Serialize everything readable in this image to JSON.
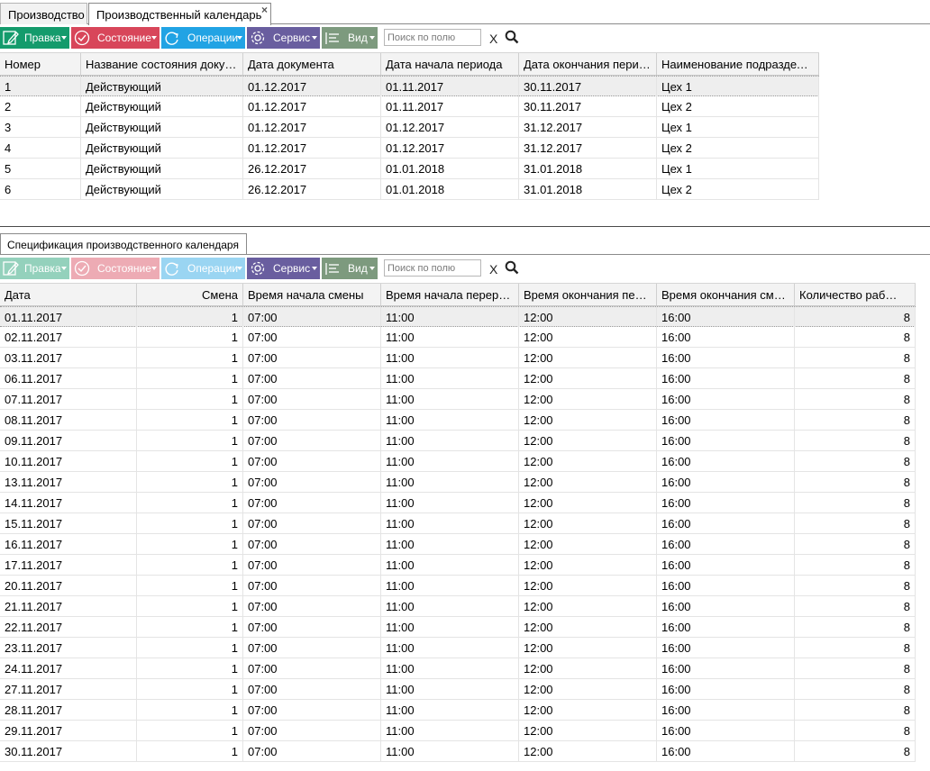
{
  "tabs": [
    {
      "label": "Производство"
    },
    {
      "label": "Производственный календарь",
      "close": "×"
    }
  ],
  "toolbar": {
    "edit_label": "Правка",
    "state_label": "Состояние",
    "ops_label": "Операции",
    "service_label": "Сервис",
    "view_label": "Вид",
    "search_placeholder": "Поиск по полю",
    "clear_label": "X"
  },
  "colors": {
    "edit": "#149b6c",
    "state": "#d8465a",
    "ops": "#21a3e4",
    "service": "#695e9f",
    "view": "#7d9a7e"
  },
  "icons": [
    "pencil-icon",
    "check-circle-icon",
    "refresh-icon",
    "gear-icon",
    "list-icon",
    "search-icon",
    "close-icon"
  ],
  "calendar_table": {
    "columns": [
      "Номер",
      "Название состояния доку…",
      "Дата документа",
      "Дата начала периода",
      "Дата окончания пери…",
      "Наименование подраздел…"
    ],
    "rows": [
      [
        "1",
        "Действующий",
        "01.12.2017",
        "01.11.2017",
        "30.11.2017",
        "Цех 1"
      ],
      [
        "2",
        "Действующий",
        "01.12.2017",
        "01.11.2017",
        "30.11.2017",
        "Цех 2"
      ],
      [
        "3",
        "Действующий",
        "01.12.2017",
        "01.12.2017",
        "31.12.2017",
        "Цех 1"
      ],
      [
        "4",
        "Действующий",
        "01.12.2017",
        "01.12.2017",
        "31.12.2017",
        "Цех 2"
      ],
      [
        "5",
        "Действующий",
        "26.12.2017",
        "01.01.2018",
        "31.01.2018",
        "Цех 1"
      ],
      [
        "6",
        "Действующий",
        "26.12.2017",
        "01.01.2018",
        "31.01.2018",
        "Цех 2"
      ]
    ]
  },
  "spec_tab": {
    "label": "Спецификация производственного календаря"
  },
  "spec_table": {
    "columns": [
      "Дата",
      "Смена",
      "Время начала смены",
      "Время начала перер…",
      "Время окончания пер…",
      "Время окончания см…",
      "Количество раб…"
    ],
    "rows": [
      [
        "01.11.2017",
        "1",
        "07:00",
        "11:00",
        "12:00",
        "16:00",
        "8"
      ],
      [
        "02.11.2017",
        "1",
        "07:00",
        "11:00",
        "12:00",
        "16:00",
        "8"
      ],
      [
        "03.11.2017",
        "1",
        "07:00",
        "11:00",
        "12:00",
        "16:00",
        "8"
      ],
      [
        "06.11.2017",
        "1",
        "07:00",
        "11:00",
        "12:00",
        "16:00",
        "8"
      ],
      [
        "07.11.2017",
        "1",
        "07:00",
        "11:00",
        "12:00",
        "16:00",
        "8"
      ],
      [
        "08.11.2017",
        "1",
        "07:00",
        "11:00",
        "12:00",
        "16:00",
        "8"
      ],
      [
        "09.11.2017",
        "1",
        "07:00",
        "11:00",
        "12:00",
        "16:00",
        "8"
      ],
      [
        "10.11.2017",
        "1",
        "07:00",
        "11:00",
        "12:00",
        "16:00",
        "8"
      ],
      [
        "13.11.2017",
        "1",
        "07:00",
        "11:00",
        "12:00",
        "16:00",
        "8"
      ],
      [
        "14.11.2017",
        "1",
        "07:00",
        "11:00",
        "12:00",
        "16:00",
        "8"
      ],
      [
        "15.11.2017",
        "1",
        "07:00",
        "11:00",
        "12:00",
        "16:00",
        "8"
      ],
      [
        "16.11.2017",
        "1",
        "07:00",
        "11:00",
        "12:00",
        "16:00",
        "8"
      ],
      [
        "17.11.2017",
        "1",
        "07:00",
        "11:00",
        "12:00",
        "16:00",
        "8"
      ],
      [
        "20.11.2017",
        "1",
        "07:00",
        "11:00",
        "12:00",
        "16:00",
        "8"
      ],
      [
        "21.11.2017",
        "1",
        "07:00",
        "11:00",
        "12:00",
        "16:00",
        "8"
      ],
      [
        "22.11.2017",
        "1",
        "07:00",
        "11:00",
        "12:00",
        "16:00",
        "8"
      ],
      [
        "23.11.2017",
        "1",
        "07:00",
        "11:00",
        "12:00",
        "16:00",
        "8"
      ],
      [
        "24.11.2017",
        "1",
        "07:00",
        "11:00",
        "12:00",
        "16:00",
        "8"
      ],
      [
        "27.11.2017",
        "1",
        "07:00",
        "11:00",
        "12:00",
        "16:00",
        "8"
      ],
      [
        "28.11.2017",
        "1",
        "07:00",
        "11:00",
        "12:00",
        "16:00",
        "8"
      ],
      [
        "29.11.2017",
        "1",
        "07:00",
        "11:00",
        "12:00",
        "16:00",
        "8"
      ],
      [
        "30.11.2017",
        "1",
        "07:00",
        "11:00",
        "12:00",
        "16:00",
        "8"
      ]
    ]
  }
}
